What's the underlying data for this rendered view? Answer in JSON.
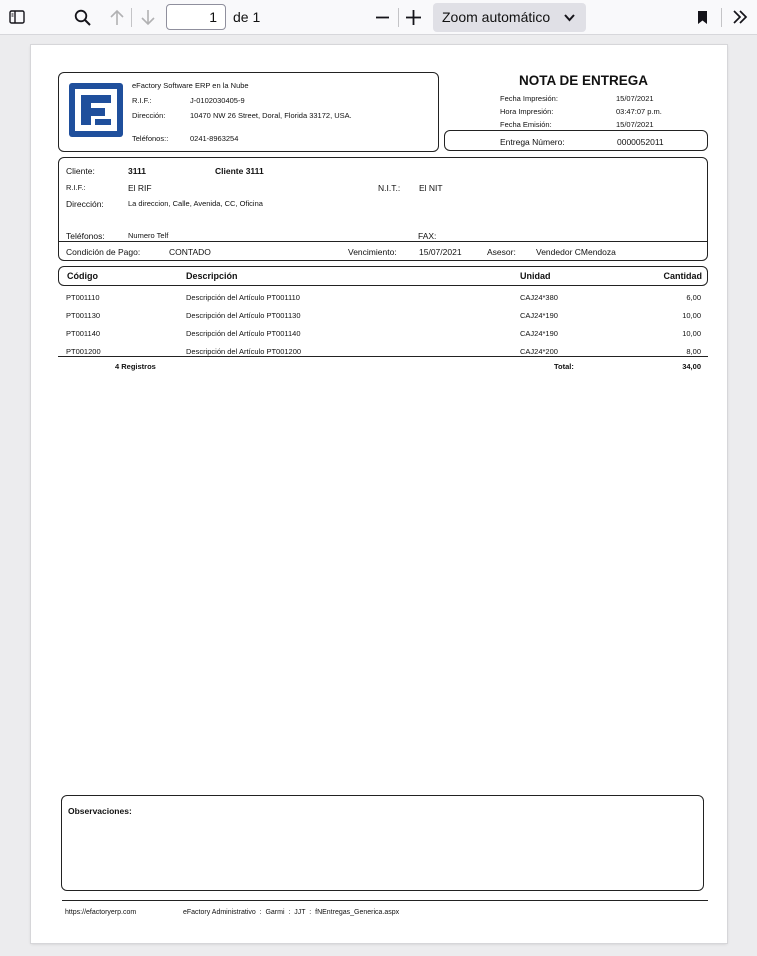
{
  "toolbar": {
    "page_current": "1",
    "page_of": "de 1",
    "zoom": "Zoom automático",
    "icons": [
      "sidebar-toggle-icon",
      "search-icon",
      "arrow-up-icon",
      "arrow-down-icon",
      "minus-icon",
      "plus-icon",
      "chevron-down-icon",
      "bookmark-icon",
      "double-chevron-right-icon"
    ]
  },
  "company": {
    "name": "eFactory Software ERP en la Nube",
    "rif_label": "R.I.F.:",
    "rif": "J-0102030405-9",
    "address_label": "Dirección:",
    "address": "10470 NW 26 Street, Doral, Florida 33172, USA.",
    "phones_label": "Teléfonos::",
    "phones": "0241-8963254",
    "logo_color": "#1f4f9c"
  },
  "doc": {
    "title": "NOTA DE ENTREGA",
    "fecha_impresion_label": "Fecha Impresión:",
    "fecha_impresion": "15/07/2021",
    "hora_impresion_label": "Hora Impresión:",
    "hora_impresion": "03:47:07 p.m.",
    "fecha_emision_label": "Fecha Emisión:",
    "fecha_emision": "15/07/2021",
    "entrega_label": "Entrega Número:",
    "entrega_numero": "0000052011"
  },
  "client": {
    "cliente_label": "Cliente:",
    "cliente_code": "3111",
    "cliente_name": "Cliente 3111",
    "rif_label": "R.I.F.:",
    "rif": "El RIF",
    "nit_label": "N.I.T.:",
    "nit": "El NIT",
    "direccion_label": "Dirección:",
    "direccion": "La direccion, Calle, Avenida, CC, Oficina",
    "telefonos_label": "Teléfonos:",
    "telefonos": "Numero Telf",
    "fax_label": "FAX:",
    "condicion_label": "Condición de Pago:",
    "condicion": "CONTADO",
    "vencimiento_label": "Vencimiento:",
    "vencimiento": "15/07/2021",
    "asesor_label": "Asesor:",
    "asesor": "Vendedor CMendoza"
  },
  "table": {
    "headers": {
      "codigo": "Código",
      "descripcion": "Descripción",
      "unidad": "Unidad",
      "cantidad": "Cantidad"
    },
    "rows": [
      {
        "codigo": "PT001110",
        "descripcion": "Descripción del Artículo PT001110",
        "unidad": "CAJ24*380",
        "cantidad": "6,00"
      },
      {
        "codigo": "PT001130",
        "descripcion": "Descripción del Artículo PT001130",
        "unidad": "CAJ24*190",
        "cantidad": "10,00"
      },
      {
        "codigo": "PT001140",
        "descripcion": "Descripción del Artículo PT001140",
        "unidad": "CAJ24*190",
        "cantidad": "10,00"
      },
      {
        "codigo": "PT001200",
        "descripcion": "Descripción del Artículo PT001200",
        "unidad": "CAJ24*200",
        "cantidad": "8,00"
      }
    ],
    "registros": "4  Registros",
    "total_label": "Total:",
    "total": "34,00"
  },
  "observaciones_label": "Observaciones:",
  "footer": {
    "url": "https://efactoryerp.com",
    "info": "eFactory Administrativo  :  Garmi  :  JJT  :  fNEntregas_Generica.aspx"
  }
}
